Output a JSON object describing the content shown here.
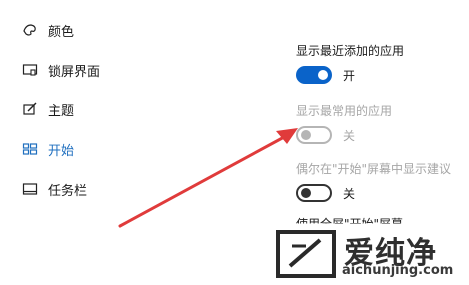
{
  "sidebar": {
    "items": [
      {
        "label": "颜色",
        "icon": "palette-icon"
      },
      {
        "label": "锁屏界面",
        "icon": "lock-screen-icon"
      },
      {
        "label": "主题",
        "icon": "theme-brush-icon"
      },
      {
        "label": "开始",
        "icon": "start-grid-icon",
        "active": true
      },
      {
        "label": "任务栏",
        "icon": "taskbar-icon"
      }
    ]
  },
  "settings": {
    "recent_apps": {
      "label": "显示最近添加的应用",
      "state": "开"
    },
    "most_used": {
      "label": "显示最常用的应用",
      "state": "关"
    },
    "suggestions": {
      "label": "偶尔在\"开始\"屏幕中显示建议",
      "state": "关"
    },
    "fullscreen": {
      "label": "使用全屏\"开始\"屏幕"
    }
  },
  "watermark": {
    "cn": "爱纯净",
    "url": "aichunjing.com"
  },
  "colors": {
    "accent": "#0a63c9",
    "arrow": "#e03b3b",
    "active_text": "#1f6fbf"
  }
}
